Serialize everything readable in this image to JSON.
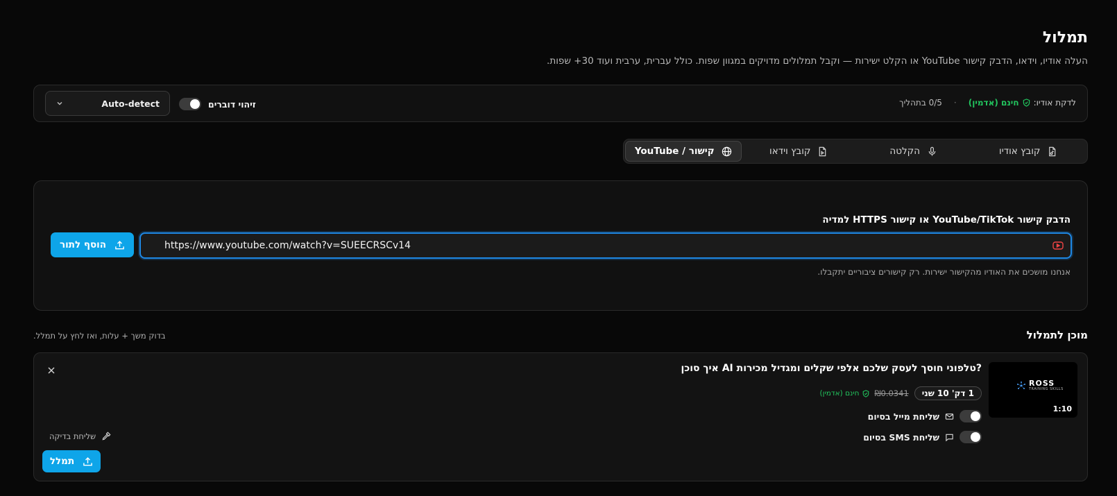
{
  "header": {
    "title": "תמלול",
    "subtitle": "העלה אודיו, וידאו, הדבק קישור YouTube או הקלט ישירות — וקבל תמלולים מדויקים במגוון שפות. כולל עברית, ערבית ועוד 30+ שפות."
  },
  "status": {
    "audio_minutes_label": "לדקת אודיו:",
    "free_label": "חינם (אדמין)",
    "separator": "·",
    "queue": "0/5 בתהליך",
    "speaker_id_label": "זיהוי דוברים",
    "speaker_id_enabled": true,
    "language_value": "Auto-detect"
  },
  "tabs": [
    {
      "label": "קובץ אודיו",
      "icon": "audio-file-icon",
      "active": false
    },
    {
      "label": "הקלטה",
      "icon": "mic-icon",
      "active": false
    },
    {
      "label": "קובץ וידאו",
      "icon": "video-file-icon",
      "active": false
    },
    {
      "label": "קישור / YouTube",
      "icon": "globe-icon",
      "active": true
    }
  ],
  "url_section": {
    "label": "הדבק קישור YouTube/TikTok או קישור HTTPS למדיה",
    "value": "https://www.youtube.com/watch?v=SUEECRSCv14",
    "add_button": "הוסף לתור",
    "hint": "אנחנו מושכים את האודיו מהקישור ישירות. רק קישורים ציבוריים יתקבלו."
  },
  "ready": {
    "title": "מוכן לתמלול",
    "hint": "בדוק משך + עלות, ואז לחץ על תמלל.",
    "item": {
      "thumb_brand": "ROSS",
      "thumb_brand_sub": "TRAINING SKILLS",
      "thumb_duration": "1:10",
      "title": "?טלפוני חוסך לעסק שלכם אלפי שקלים ומגדיל מכירות AI איך סוכן",
      "duration_badge": "1 דק' 10 שני",
      "old_price": "₪0.0341",
      "free_label": "חינם (אדמין)",
      "email_option": "שליחת מייל בסיום",
      "sms_option": "שליחת SMS בסיום",
      "email_enabled": false,
      "sms_enabled": false,
      "test_send": "שליחת בדיקה",
      "transcribe_button": "תמלל"
    }
  },
  "colors": {
    "accent": "#0ea5e9",
    "success": "#22c55e",
    "focus": "#1e88e5",
    "youtube": "#ef4444"
  }
}
